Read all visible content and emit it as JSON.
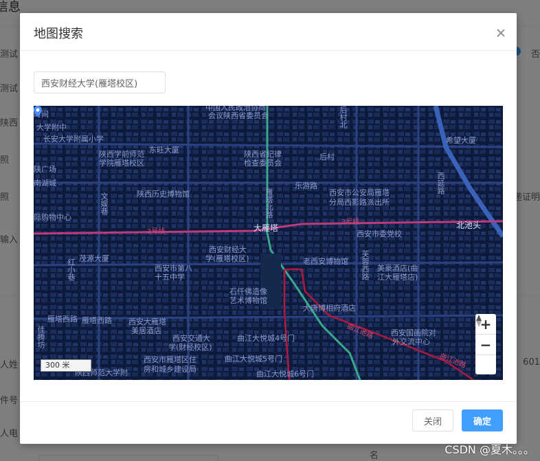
{
  "background": {
    "title": "信息",
    "labels": [
      "测试",
      "测试",
      "陕西",
      "照",
      "照",
      "输入",
      "人姓",
      "件号",
      "人电"
    ],
    "right": [
      "否",
      "递证明",
      "601",
      "名"
    ]
  },
  "dialog": {
    "title": "地图搜索",
    "search": {
      "value": "西安财经大学(雁塔校区)"
    },
    "footer": {
      "cancel_label": "关闭",
      "confirm_label": "确定"
    }
  },
  "map": {
    "scale_label": "300 米",
    "zoom_in": "+",
    "zoom_out": "−",
    "pin_label": "大雁塔",
    "labels": [
      {
        "t": "时间"
      },
      {
        "t": "大学附中"
      },
      {
        "t": "长安大学附属小学"
      },
      {
        "t": "中国人民政治协商"
      },
      {
        "t": "会议陕西省委员会"
      },
      {
        "t": "陕西学前师范"
      },
      {
        "t": "学院雁塔校区"
      },
      {
        "t": "陕西省纪律"
      },
      {
        "t": "检查委员会"
      },
      {
        "t": "后村"
      },
      {
        "t": "后村北"
      },
      {
        "t": "希望大厦"
      },
      {
        "t": "东旺大厦"
      },
      {
        "t": "陕广场"
      },
      {
        "t": "南湖城"
      },
      {
        "t": "文娱巷"
      },
      {
        "t": "陕西历史博物馆"
      },
      {
        "t": "雁塔北路"
      },
      {
        "t": "乐游路"
      },
      {
        "t": "西安市公安局雁塔"
      },
      {
        "t": "分局西影路派出所"
      },
      {
        "t": "西延路"
      },
      {
        "t": "际购物中心"
      },
      {
        "t": "3号线"
      },
      {
        "t": "大雁塔"
      },
      {
        "t": "3号线"
      },
      {
        "t": "北池头"
      },
      {
        "t": "西安市委党校"
      },
      {
        "t": "西安财经大"
      },
      {
        "t": "学(雁塔校区)"
      },
      {
        "t": "老西安博物馆"
      },
      {
        "t": "茂源大厦"
      },
      {
        "t": "红小巷"
      },
      {
        "t": "西安市第八"
      },
      {
        "t": "十五中学"
      },
      {
        "t": "芙蓉西路"
      },
      {
        "t": "美豪酒店(曲"
      },
      {
        "t": "江大雁塔店)"
      },
      {
        "t": "石仟佛造像"
      },
      {
        "t": "艺术博物馆"
      },
      {
        "t": "大唐博相府酒店"
      },
      {
        "t": "雁塔西路"
      },
      {
        "t": "雁塔西路"
      },
      {
        "t": "西安大雁塔"
      },
      {
        "t": "美居酒店"
      },
      {
        "t": "西安国画院对"
      },
      {
        "t": "外交流中心"
      },
      {
        "t": "佳腾坊"
      },
      {
        "t": "西安交通大"
      },
      {
        "t": "学(财经校区)"
      },
      {
        "t": "曲江大悦城4号门"
      },
      {
        "t": "曲江大悦城5号门"
      },
      {
        "t": "西安市雁塔区住"
      },
      {
        "t": "房和城乡建设局"
      },
      {
        "t": "曲江大悦城6号门"
      },
      {
        "t": "陕西师范大学附"
      },
      {
        "t": "曲江池路"
      },
      {
        "t": "曲江池路"
      }
    ]
  },
  "watermark": "CSDN @夏木。。。",
  "colors": {
    "primary": "#409eff",
    "map_bg": "#0e1a3b",
    "metro_line3": "#c0397a",
    "road_highlight": "#39a98a"
  }
}
